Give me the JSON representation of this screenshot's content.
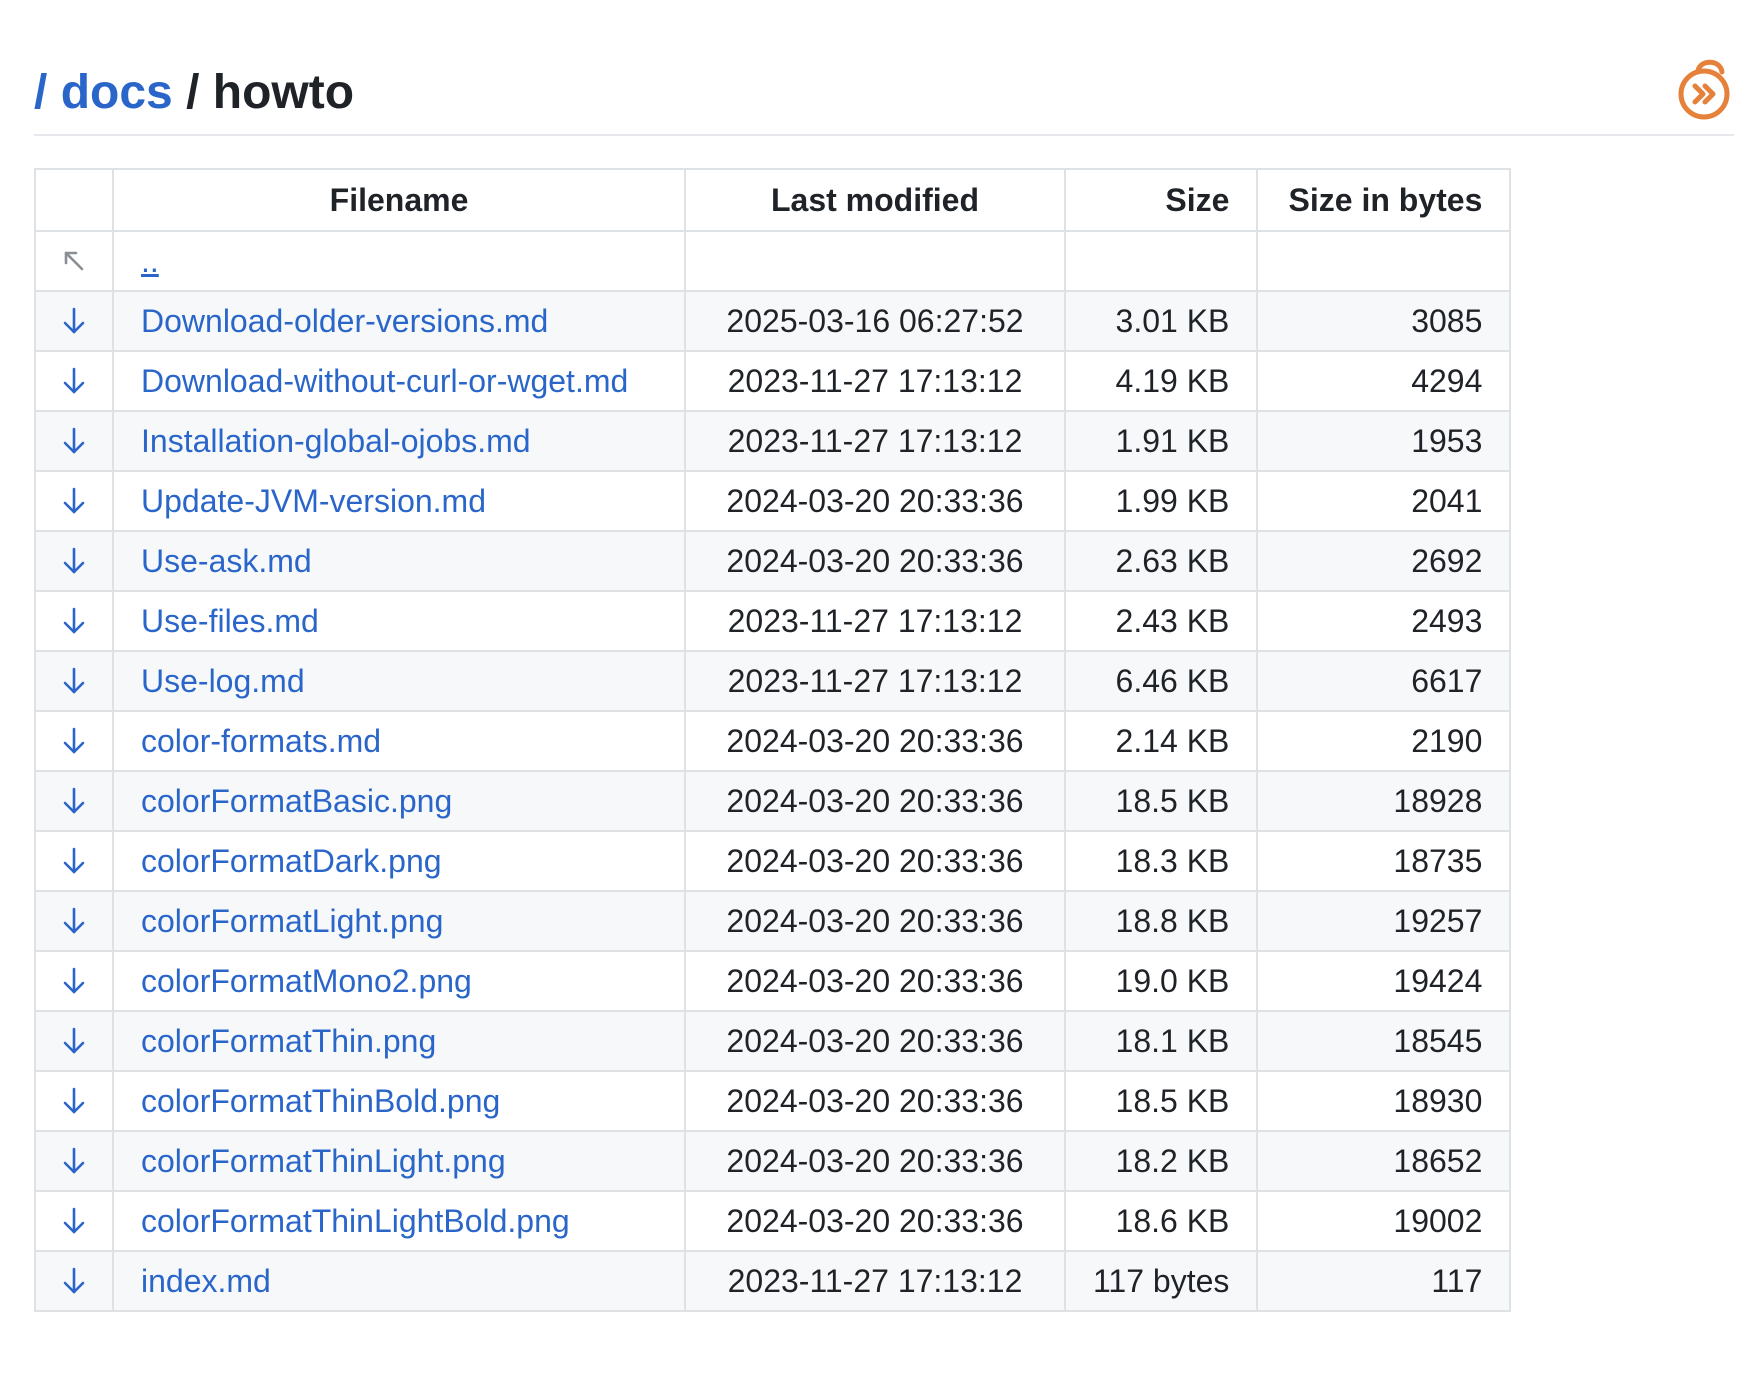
{
  "breadcrumb": {
    "root_sep": "/",
    "docs": "docs",
    "sep": "/",
    "current": "howto"
  },
  "brand": {
    "logo_icon": "openaf-logo-icon",
    "accent": "#e5813a",
    "link": "#2a66c9"
  },
  "table": {
    "headers": {
      "filename": "Filename",
      "last_modified": "Last modified",
      "size": "Size",
      "size_bytes": "Size in bytes"
    },
    "parent": {
      "icon": "arrow-up-left-icon",
      "label": ".."
    },
    "rows": [
      {
        "icon": "download-arrow-icon",
        "name": "Download-older-versions.md",
        "modified": "2025-03-16 06:27:52",
        "size": "3.01 KB",
        "bytes": "3085"
      },
      {
        "icon": "download-arrow-icon",
        "name": "Download-without-curl-or-wget.md",
        "modified": "2023-11-27 17:13:12",
        "size": "4.19 KB",
        "bytes": "4294"
      },
      {
        "icon": "download-arrow-icon",
        "name": "Installation-global-ojobs.md",
        "modified": "2023-11-27 17:13:12",
        "size": "1.91 KB",
        "bytes": "1953"
      },
      {
        "icon": "download-arrow-icon",
        "name": "Update-JVM-version.md",
        "modified": "2024-03-20 20:33:36",
        "size": "1.99 KB",
        "bytes": "2041"
      },
      {
        "icon": "download-arrow-icon",
        "name": "Use-ask.md",
        "modified": "2024-03-20 20:33:36",
        "size": "2.63 KB",
        "bytes": "2692"
      },
      {
        "icon": "download-arrow-icon",
        "name": "Use-files.md",
        "modified": "2023-11-27 17:13:12",
        "size": "2.43 KB",
        "bytes": "2493"
      },
      {
        "icon": "download-arrow-icon",
        "name": "Use-log.md",
        "modified": "2023-11-27 17:13:12",
        "size": "6.46 KB",
        "bytes": "6617"
      },
      {
        "icon": "download-arrow-icon",
        "name": "color-formats.md",
        "modified": "2024-03-20 20:33:36",
        "size": "2.14 KB",
        "bytes": "2190"
      },
      {
        "icon": "download-arrow-icon",
        "name": "colorFormatBasic.png",
        "modified": "2024-03-20 20:33:36",
        "size": "18.5 KB",
        "bytes": "18928"
      },
      {
        "icon": "download-arrow-icon",
        "name": "colorFormatDark.png",
        "modified": "2024-03-20 20:33:36",
        "size": "18.3 KB",
        "bytes": "18735"
      },
      {
        "icon": "download-arrow-icon",
        "name": "colorFormatLight.png",
        "modified": "2024-03-20 20:33:36",
        "size": "18.8 KB",
        "bytes": "19257"
      },
      {
        "icon": "download-arrow-icon",
        "name": "colorFormatMono2.png",
        "modified": "2024-03-20 20:33:36",
        "size": "19.0 KB",
        "bytes": "19424"
      },
      {
        "icon": "download-arrow-icon",
        "name": "colorFormatThin.png",
        "modified": "2024-03-20 20:33:36",
        "size": "18.1 KB",
        "bytes": "18545"
      },
      {
        "icon": "download-arrow-icon",
        "name": "colorFormatThinBold.png",
        "modified": "2024-03-20 20:33:36",
        "size": "18.5 KB",
        "bytes": "18930"
      },
      {
        "icon": "download-arrow-icon",
        "name": "colorFormatThinLight.png",
        "modified": "2024-03-20 20:33:36",
        "size": "18.2 KB",
        "bytes": "18652"
      },
      {
        "icon": "download-arrow-icon",
        "name": "colorFormatThinLightBold.png",
        "modified": "2024-03-20 20:33:36",
        "size": "18.6 KB",
        "bytes": "19002"
      },
      {
        "icon": "download-arrow-icon",
        "name": "index.md",
        "modified": "2023-11-27 17:13:12",
        "size": "117 bytes",
        "bytes": "117"
      }
    ]
  }
}
